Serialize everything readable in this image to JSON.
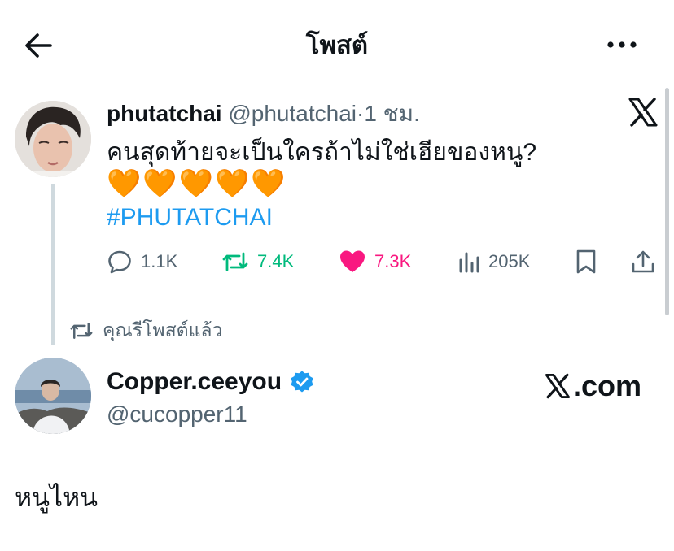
{
  "header": {
    "title": "โพสต์"
  },
  "tweet": {
    "name": "phutatchai",
    "handle": "@phutatchai",
    "separator": "·",
    "time": "1 ชม.",
    "text": "คนสุดท้ายจะเป็นใครถ้าไม่ใช่เฮียของหนู?",
    "hearts": "🧡🧡🧡🧡🧡",
    "hashtag": "#PHUTATCHAI",
    "stats": {
      "replies": "1.1K",
      "reposts": "7.4K",
      "likes": "7.3K",
      "views": "205K"
    }
  },
  "repost_notice": "คุณรีโพสต์แล้ว",
  "quoted_account": {
    "name": "Copper.ceeyou",
    "handle": "@cucopper11",
    "site_label": ".com"
  },
  "reply_text": "หนูไหน",
  "colors": {
    "text": "#0f1419",
    "muted": "#536471",
    "accent_blue": "#1d9bf0",
    "repost_green": "#00ba7c",
    "like_pink": "#f91880",
    "heart_orange": "#f4900c"
  },
  "icons": [
    "back-arrow-icon",
    "more-icon",
    "x-logo-icon",
    "reply-icon",
    "repost-icon",
    "like-icon",
    "views-icon",
    "bookmark-icon",
    "share-icon",
    "verified-badge-icon"
  ]
}
